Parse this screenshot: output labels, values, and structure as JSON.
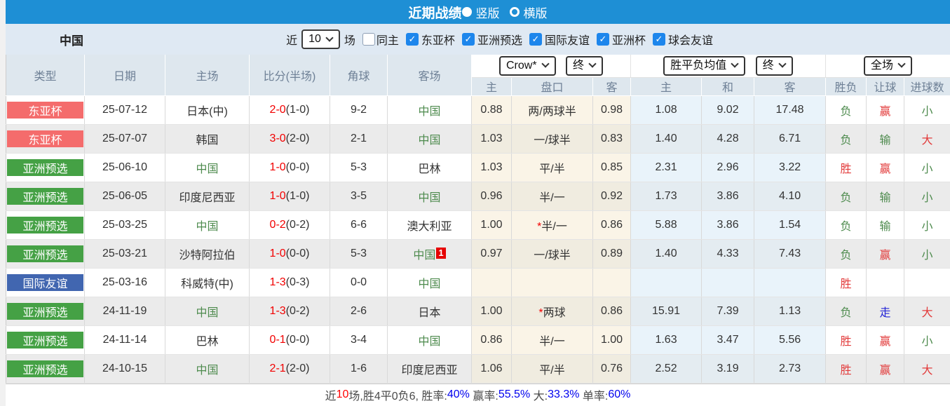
{
  "colors": {
    "titlebar_bg": "#1e8fd5",
    "filter_bg": "#dfe9f3",
    "header_bg": "#dee7ee",
    "row_alt_bg": "#ebebeb",
    "type_red": "#f46c6c",
    "type_green": "#45a145",
    "type_blue": "#4166b0",
    "checkbox_blue": "#1d86ec",
    "china_green": "#4e8b4e",
    "score_red": "#f20000",
    "badge_red": "#e60000",
    "win_red": "#e23b3b",
    "lose_green": "#4e8b4e",
    "push_blue": "#2323d6",
    "stat_blue": "#0000ee",
    "stat_red": "#ff0000",
    "footer_dark": "#4a4a4a"
  },
  "titlebar": {
    "title": "近期战绩",
    "vertical_label": "竖版",
    "horizontal_label": "横版",
    "selected": "竖版"
  },
  "filter": {
    "team": "中国",
    "recent_label": "近",
    "recent_value": "10",
    "games_label": "场",
    "same_home": {
      "label": "同主",
      "checked": false
    },
    "competitions": [
      {
        "label": "东亚杯",
        "checked": true
      },
      {
        "label": "亚洲预选",
        "checked": true
      },
      {
        "label": "国际友谊",
        "checked": true
      },
      {
        "label": "亚洲杯",
        "checked": true
      },
      {
        "label": "球会友谊",
        "checked": true
      }
    ]
  },
  "table": {
    "headers": {
      "type": "类型",
      "date": "日期",
      "home": "主场",
      "score": "比分(半场)",
      "corner": "角球",
      "away": "客场"
    },
    "selectors": {
      "odds_company": "Crow*",
      "odds_time": "终",
      "mean": "胜平负均值",
      "mean_time": "终",
      "scope": "全场"
    },
    "sub_headers": [
      "主",
      "盘口",
      "客",
      "主",
      "和",
      "客",
      "胜负",
      "让球",
      "进球数"
    ],
    "rows": [
      {
        "type": "东亚杯",
        "type_color": "red",
        "date": "25-07-12",
        "home": "日本(中)",
        "home_china": false,
        "score": "2-0",
        "half": "(1-0)",
        "corner": "9-2",
        "away": "中国",
        "away_china": true,
        "away_badge": "",
        "odds_home": "0.88",
        "handicap": "两/两球半",
        "odds_away": "0.98",
        "mean_home": "1.08",
        "mean_draw": "9.02",
        "mean_away": "17.48",
        "result": "负",
        "result_color": "g",
        "handicap_result": "赢",
        "handicap_color": "r",
        "goals": "小",
        "goals_color": "g"
      },
      {
        "type": "东亚杯",
        "type_color": "red",
        "date": "25-07-07",
        "home": "韩国",
        "home_china": false,
        "score": "3-0",
        "half": "(2-0)",
        "corner": "2-1",
        "away": "中国",
        "away_china": true,
        "away_badge": "",
        "odds_home": "1.03",
        "handicap": "一/球半",
        "odds_away": "0.83",
        "mean_home": "1.40",
        "mean_draw": "4.28",
        "mean_away": "6.71",
        "result": "负",
        "result_color": "g",
        "handicap_result": "输",
        "handicap_color": "g",
        "goals": "大",
        "goals_color": "r"
      },
      {
        "type": "亚洲预选",
        "type_color": "green",
        "date": "25-06-10",
        "home": "中国",
        "home_china": true,
        "score": "1-0",
        "half": "(0-0)",
        "corner": "5-3",
        "away": "巴林",
        "away_china": false,
        "away_badge": "",
        "odds_home": "1.03",
        "handicap": "平/半",
        "odds_away": "0.85",
        "mean_home": "2.31",
        "mean_draw": "2.96",
        "mean_away": "3.22",
        "result": "胜",
        "result_color": "r",
        "handicap_result": "赢",
        "handicap_color": "r",
        "goals": "小",
        "goals_color": "g"
      },
      {
        "type": "亚洲预选",
        "type_color": "green",
        "date": "25-06-05",
        "home": "印度尼西亚",
        "home_china": false,
        "score": "1-0",
        "half": "(1-0)",
        "corner": "3-5",
        "away": "中国",
        "away_china": true,
        "away_badge": "",
        "odds_home": "0.96",
        "handicap": "半/一",
        "odds_away": "0.92",
        "mean_home": "1.73",
        "mean_draw": "3.86",
        "mean_away": "4.10",
        "result": "负",
        "result_color": "g",
        "handicap_result": "输",
        "handicap_color": "g",
        "goals": "小",
        "goals_color": "g"
      },
      {
        "type": "亚洲预选",
        "type_color": "green",
        "date": "25-03-25",
        "home": "中国",
        "home_china": true,
        "score": "0-2",
        "half": "(0-2)",
        "corner": "6-6",
        "away": "澳大利亚",
        "away_china": false,
        "away_badge": "",
        "odds_home": "1.00",
        "handicap": "*半/一",
        "odds_away": "0.86",
        "mean_home": "5.88",
        "mean_draw": "3.86",
        "mean_away": "1.54",
        "result": "负",
        "result_color": "g",
        "handicap_result": "输",
        "handicap_color": "g",
        "goals": "小",
        "goals_color": "g"
      },
      {
        "type": "亚洲预选",
        "type_color": "green",
        "date": "25-03-21",
        "home": "沙特阿拉伯",
        "home_china": false,
        "score": "1-0",
        "half": "(0-0)",
        "corner": "5-3",
        "away": "中国",
        "away_china": true,
        "away_badge": "1",
        "odds_home": "0.97",
        "handicap": "一/球半",
        "odds_away": "0.89",
        "mean_home": "1.40",
        "mean_draw": "4.33",
        "mean_away": "7.43",
        "result": "负",
        "result_color": "g",
        "handicap_result": "赢",
        "handicap_color": "r",
        "goals": "小",
        "goals_color": "g"
      },
      {
        "type": "国际友谊",
        "type_color": "blue",
        "date": "25-03-16",
        "home": "科威特(中)",
        "home_china": false,
        "score": "1-3",
        "half": "(0-3)",
        "corner": "0-0",
        "away": "中国",
        "away_china": true,
        "away_badge": "",
        "odds_home": "",
        "handicap": "",
        "odds_away": "",
        "mean_home": "",
        "mean_draw": "",
        "mean_away": "",
        "result": "胜",
        "result_color": "r",
        "handicap_result": "",
        "handicap_color": "",
        "goals": "",
        "goals_color": ""
      },
      {
        "type": "亚洲预选",
        "type_color": "green",
        "date": "24-11-19",
        "home": "中国",
        "home_china": true,
        "score": "1-3",
        "half": "(0-2)",
        "corner": "2-6",
        "away": "日本",
        "away_china": false,
        "away_badge": "",
        "odds_home": "1.00",
        "handicap": "*两球",
        "odds_away": "0.86",
        "mean_home": "15.91",
        "mean_draw": "7.39",
        "mean_away": "1.13",
        "result": "负",
        "result_color": "g",
        "handicap_result": "走",
        "handicap_color": "b",
        "goals": "大",
        "goals_color": "r"
      },
      {
        "type": "亚洲预选",
        "type_color": "green",
        "date": "24-11-14",
        "home": "巴林",
        "home_china": false,
        "score": "0-1",
        "half": "(0-0)",
        "corner": "3-4",
        "away": "中国",
        "away_china": true,
        "away_badge": "",
        "odds_home": "0.86",
        "handicap": "半/一",
        "odds_away": "1.00",
        "mean_home": "1.63",
        "mean_draw": "3.47",
        "mean_away": "5.56",
        "result": "胜",
        "result_color": "r",
        "handicap_result": "赢",
        "handicap_color": "r",
        "goals": "小",
        "goals_color": "g"
      },
      {
        "type": "亚洲预选",
        "type_color": "green",
        "date": "24-10-15",
        "home": "中国",
        "home_china": true,
        "score": "2-1",
        "half": "(2-0)",
        "corner": "1-6",
        "away": "印度尼西亚",
        "away_china": false,
        "away_badge": "",
        "odds_home": "1.06",
        "handicap": "平/半",
        "odds_away": "0.76",
        "mean_home": "2.52",
        "mean_draw": "3.19",
        "mean_away": "2.73",
        "result": "胜",
        "result_color": "r",
        "handicap_result": "赢",
        "handicap_color": "r",
        "goals": "大",
        "goals_color": "r"
      }
    ]
  },
  "footer": {
    "segments": [
      {
        "text": "近",
        "color": "dark"
      },
      {
        "text": "10",
        "color": "red"
      },
      {
        "text": "场,胜4平0负6, 胜率:",
        "color": "dark"
      },
      {
        "text": "40%",
        "color": "blue"
      },
      {
        "text": " 赢率:",
        "color": "dark"
      },
      {
        "text": "55.5%",
        "color": "blue"
      },
      {
        "text": " 大:",
        "color": "dark"
      },
      {
        "text": "33.3%",
        "color": "blue"
      },
      {
        "text": " 单率:",
        "color": "dark"
      },
      {
        "text": "60%",
        "color": "blue"
      }
    ]
  }
}
